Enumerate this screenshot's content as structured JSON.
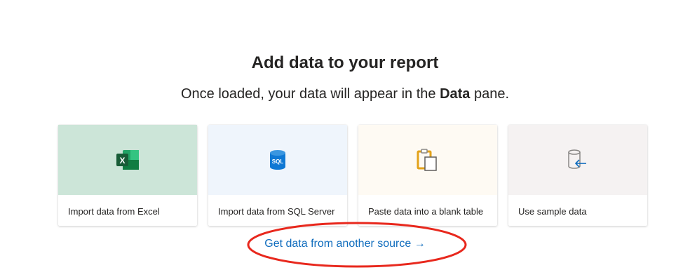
{
  "heading": "Add data to your report",
  "subheading": {
    "prefix": "Once loaded, your data will appear in the ",
    "bold": "Data",
    "suffix": " pane."
  },
  "cards": [
    {
      "label": "Import data from Excel",
      "icon": "excel-icon",
      "tile_color": "#cce5d8"
    },
    {
      "label": "Import data from SQL Server",
      "icon": "sql-database-icon",
      "tile_color": "#eff5fc"
    },
    {
      "label": "Paste data into a blank table",
      "icon": "clipboard-paste-icon",
      "tile_color": "#fefaf3"
    },
    {
      "label": "Use sample data",
      "icon": "sample-database-icon",
      "tile_color": "#f5f2f2"
    }
  ],
  "other_source_link": "Get data from another source →",
  "colors": {
    "link": "#0f6cbd",
    "annotation_circle": "#e8281d",
    "text": "#252423"
  }
}
